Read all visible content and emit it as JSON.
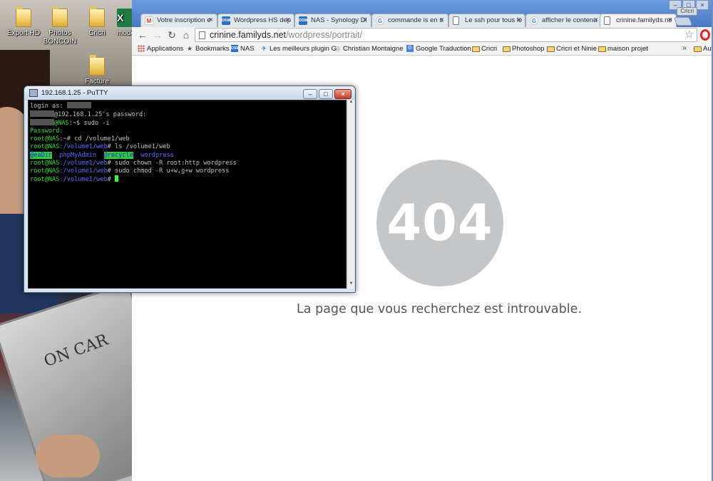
{
  "desktop": {
    "icons": [
      {
        "label": "Export HD",
        "type": "folder"
      },
      {
        "label": "Photos BONCOIN",
        "type": "folder"
      },
      {
        "label": "Cricri",
        "type": "folder"
      },
      {
        "label": "mode",
        "type": "excel"
      },
      {
        "label": "Facture",
        "type": "folder"
      }
    ],
    "book_text": "ON CAR"
  },
  "chrome": {
    "user_badge": "Cricri",
    "tabs": [
      {
        "label": "Votre inscription e",
        "icon": "gmail-icon"
      },
      {
        "label": "Wordpress HS dep",
        "icon": "dsm-icon"
      },
      {
        "label": "NAS - Synology Di",
        "icon": "dsm-icon"
      },
      {
        "label": "commande is en s",
        "icon": "google-icon"
      },
      {
        "label": "Le ssh pour tous le",
        "icon": "page-icon"
      },
      {
        "label": "afficher le contenu",
        "icon": "google-icon"
      },
      {
        "label": "crinine.familyds.ne",
        "icon": "page-icon"
      }
    ],
    "url": {
      "host": "crinine.familyds.net",
      "path": "/wordpress/portrait/"
    },
    "bookmarks": [
      {
        "label": "Applications",
        "icon": "apps-grid-icon"
      },
      {
        "label": "Bookmarks",
        "icon": "star-icon"
      },
      {
        "label": "NAS",
        "icon": "dsm-icon"
      },
      {
        "label": "Les meilleurs plugin G",
        "icon": "pin-icon"
      },
      {
        "label": "Christian Montaigne",
        "icon": "globe-icon"
      },
      {
        "label": "Google Traduction",
        "icon": "translate-icon"
      },
      {
        "label": "Cricri",
        "icon": "folder-icon"
      },
      {
        "label": "Photoshop",
        "icon": "folder-icon"
      },
      {
        "label": "Cricri et Ninie",
        "icon": "folder-icon"
      },
      {
        "label": "maison projet",
        "icon": "folder-icon"
      }
    ],
    "bookmarks_more": "»",
    "bookmarks_overflow": "Au",
    "page": {
      "code": "404",
      "message": "La page que vous recherchez est introuvable."
    }
  },
  "putty": {
    "title": "192.168.1.25 - PuTTY",
    "lines": {
      "l1": "login as: ",
      "l2": "@192.168.1.25's password:",
      "l3_host": "@NAS",
      "l3_rest": ":~$ sudo -i",
      "l4": "Password:",
      "prompt_user": "root@NAS",
      "home": ":~",
      "dir": ":/volume1/web",
      "cmd1": "# cd /volume1/web",
      "cmd2": "# ls /volume1/web",
      "ls": [
        "@eaDir",
        "phpMyAdmin",
        "@recycle",
        "wordpress"
      ],
      "cmd3": "# sudo chown -R root:http wordpress",
      "cmd4": "# sudo chmod -R u+w,g+w wordpress",
      "cmd5": "# "
    }
  },
  "colors": {
    "terminal_green": "#33dd33",
    "terminal_blue": "#5b6bff",
    "chrome_tabstrip": "#4a78c4",
    "circle_grey": "#c5c6c8"
  }
}
